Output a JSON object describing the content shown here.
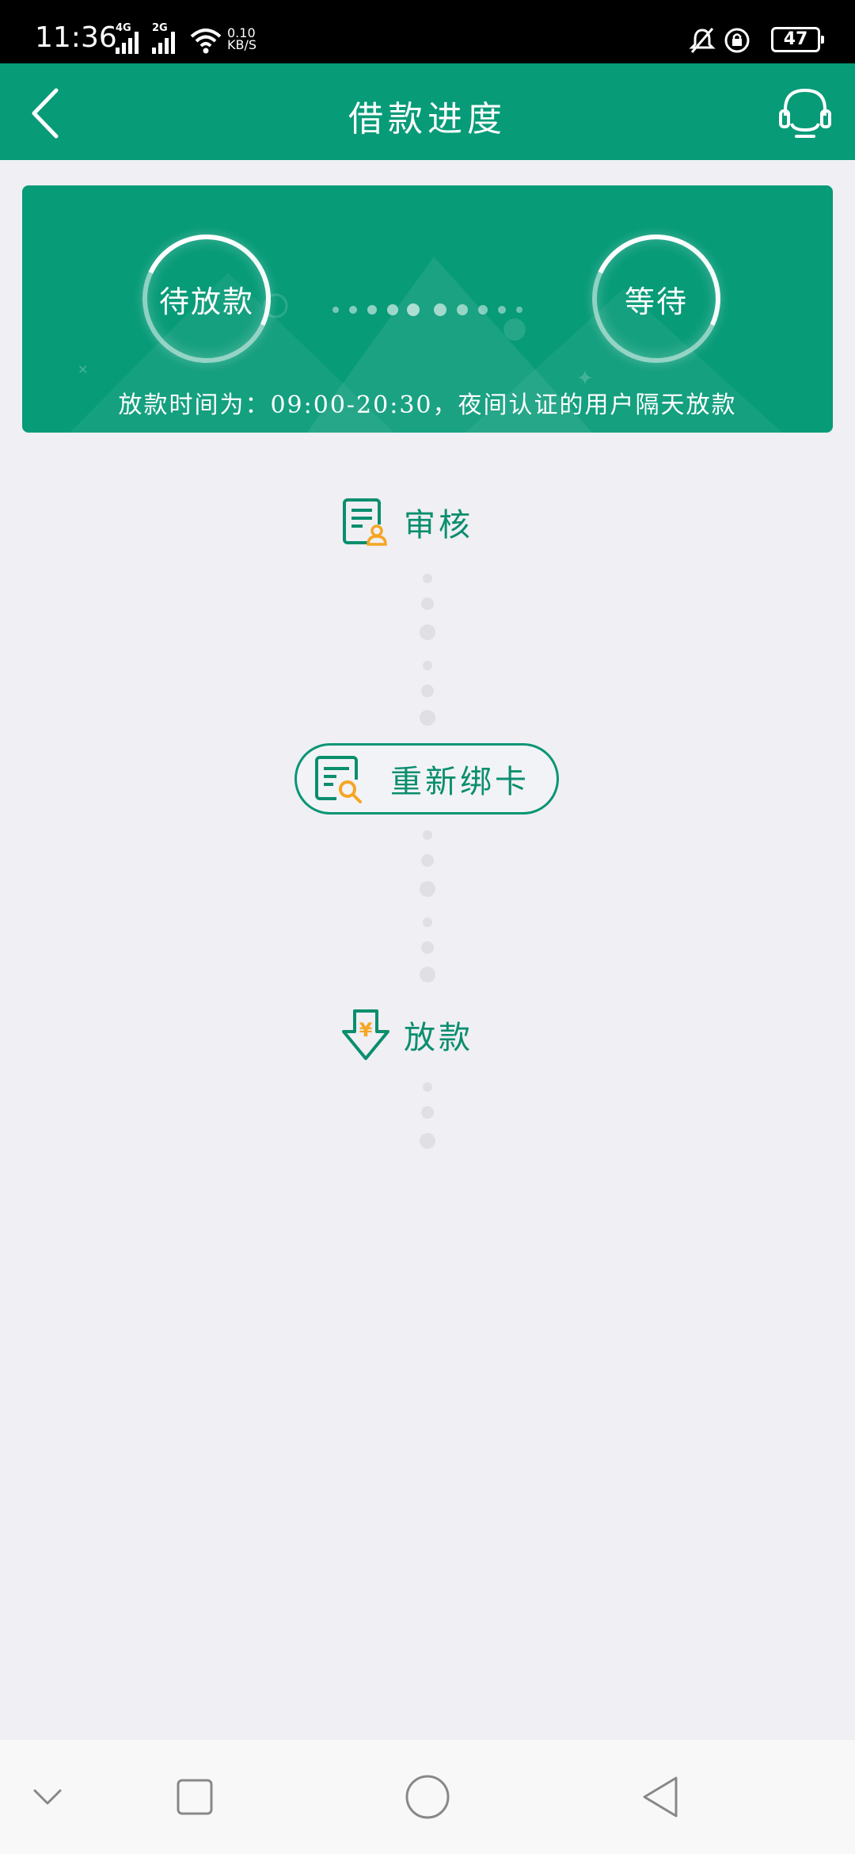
{
  "status_bar": {
    "time": "11:36",
    "signal_1_gen": "4G",
    "signal_2_gen": "2G",
    "net_speed_value": "0.10",
    "net_speed_unit": "KB/S",
    "battery": "47"
  },
  "header": {
    "title": "借款进度",
    "back_icon": "chevron-left-icon",
    "support_icon": "headset-icon"
  },
  "hero": {
    "left_status": "待放款",
    "right_status": "等待",
    "note": "放款时间为：09:00-20:30，夜间认证的用户隔天放款"
  },
  "steps": {
    "audit_label": "审核",
    "rebind_label": "重新绑卡",
    "loan_label": "放款",
    "loan_icon_symbol": "¥"
  },
  "colors": {
    "brand_green": "#079b78",
    "accent_orange": "#f5a623",
    "background": "#efeff4"
  }
}
